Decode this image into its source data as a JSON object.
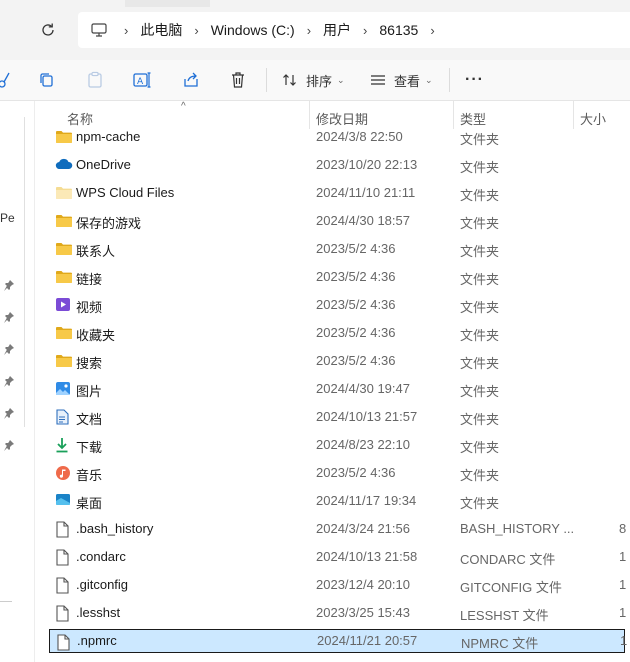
{
  "address_bar": {
    "breadcrumbs": [
      "此电脑",
      "Windows (C:)",
      "用户",
      "86135"
    ]
  },
  "toolbar": {
    "sort_label": "排序",
    "view_label": "查看",
    "more_label": "···"
  },
  "sidebar": {
    "partial_label": "Pe"
  },
  "file_list": {
    "columns": {
      "name": "名称",
      "modified": "修改日期",
      "type": "类型",
      "size": "大小"
    },
    "rows": [
      {
        "name": "npm-cache",
        "modified": "2024/3/8 22:50",
        "type": "文件夹",
        "size": "",
        "icon": "folder-icon"
      },
      {
        "name": "OneDrive",
        "modified": "2023/10/20 22:13",
        "type": "文件夹",
        "size": "",
        "icon": "onedrive-cloud-icon"
      },
      {
        "name": "WPS Cloud Files",
        "modified": "2024/11/10 21:11",
        "type": "文件夹",
        "size": "",
        "icon": "folder-light-icon"
      },
      {
        "name": "保存的游戏",
        "modified": "2024/4/30 18:57",
        "type": "文件夹",
        "size": "",
        "icon": "folder-icon"
      },
      {
        "name": "联系人",
        "modified": "2023/5/2 4:36",
        "type": "文件夹",
        "size": "",
        "icon": "folder-icon"
      },
      {
        "name": "链接",
        "modified": "2023/5/2 4:36",
        "type": "文件夹",
        "size": "",
        "icon": "folder-icon"
      },
      {
        "name": "视频",
        "modified": "2023/5/2 4:36",
        "type": "文件夹",
        "size": "",
        "icon": "videos-icon"
      },
      {
        "name": "收藏夹",
        "modified": "2023/5/2 4:36",
        "type": "文件夹",
        "size": "",
        "icon": "folder-icon"
      },
      {
        "name": "搜索",
        "modified": "2023/5/2 4:36",
        "type": "文件夹",
        "size": "",
        "icon": "folder-icon"
      },
      {
        "name": "图片",
        "modified": "2024/4/30 19:47",
        "type": "文件夹",
        "size": "",
        "icon": "pictures-icon"
      },
      {
        "name": "文档",
        "modified": "2024/10/13 21:57",
        "type": "文件夹",
        "size": "",
        "icon": "documents-icon"
      },
      {
        "name": "下载",
        "modified": "2024/8/23 22:10",
        "type": "文件夹",
        "size": "",
        "icon": "downloads-icon"
      },
      {
        "name": "音乐",
        "modified": "2023/5/2 4:36",
        "type": "文件夹",
        "size": "",
        "icon": "music-icon"
      },
      {
        "name": "桌面",
        "modified": "2024/11/17 19:34",
        "type": "文件夹",
        "size": "",
        "icon": "desktop-icon"
      },
      {
        "name": ".bash_history",
        "modified": "2024/3/24 21:56",
        "type": "BASH_HISTORY ...",
        "size": "8",
        "icon": "file-icon"
      },
      {
        "name": ".condarc",
        "modified": "2024/10/13 21:58",
        "type": "CONDARC 文件",
        "size": "1",
        "icon": "file-icon"
      },
      {
        "name": ".gitconfig",
        "modified": "2023/12/4 20:10",
        "type": "GITCONFIG 文件",
        "size": "1",
        "icon": "file-icon"
      },
      {
        "name": ".lesshst",
        "modified": "2023/3/25 15:43",
        "type": "LESSHST 文件",
        "size": "1",
        "icon": "file-icon"
      },
      {
        "name": ".npmrc",
        "modified": "2024/11/21 20:57",
        "type": "NPMRC 文件",
        "size": "1",
        "icon": "file-icon",
        "selected": true
      }
    ]
  },
  "colors": {
    "folder": "#f7c948",
    "folder_dark": "#e0a91b",
    "selection": "#cce8ff",
    "onedrive": "#0f6cbd"
  }
}
